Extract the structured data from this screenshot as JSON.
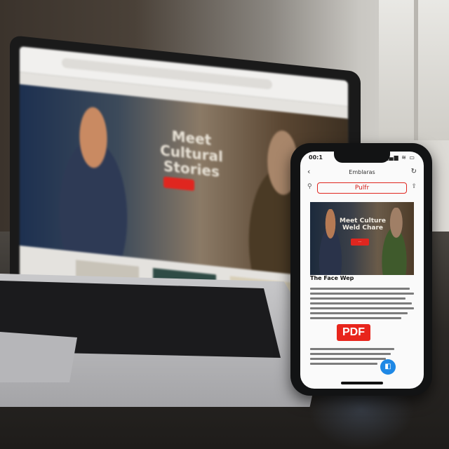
{
  "laptop": {
    "hero_title": "Meet Cultural Stories"
  },
  "phone": {
    "status": {
      "time": "00:1",
      "icons": "▂▄▆ ≋ ▭"
    },
    "header": {
      "title": "Emblaras"
    },
    "urlbar": {
      "text": "Pulfr"
    },
    "hero": {
      "title": "Meet Culture Weld Chare",
      "button": "···"
    },
    "article": {
      "heading": "The Face Wep"
    },
    "pdf_label": "PDF",
    "fab_icon": "◧"
  }
}
